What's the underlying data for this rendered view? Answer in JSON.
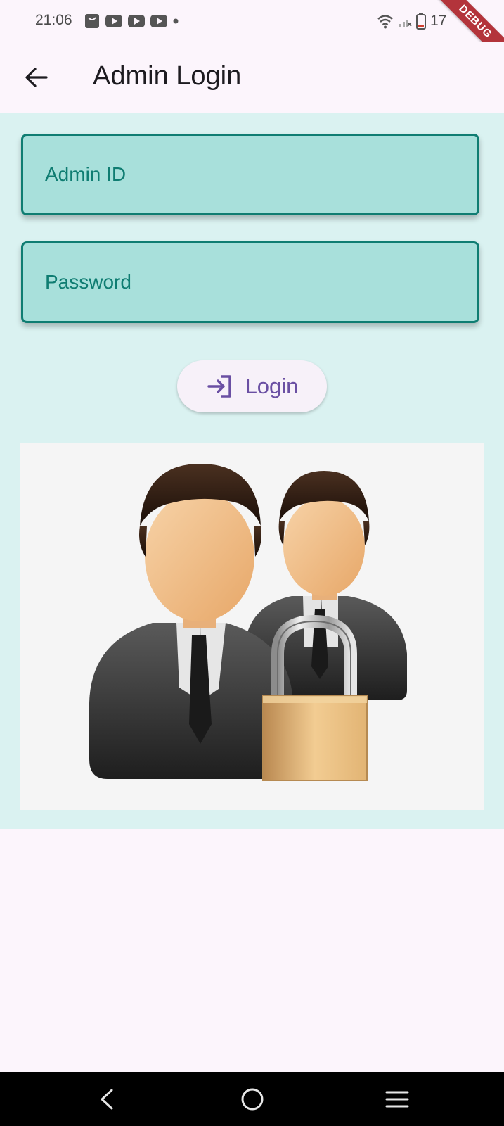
{
  "status_bar": {
    "time": "21:06",
    "battery_text": "17",
    "debug_label": "DEBUG",
    "notification_icons": [
      "bag-icon",
      "youtube-icon",
      "youtube-icon",
      "youtube-icon",
      "dot-icon"
    ],
    "system_icons": [
      "wifi-icon",
      "signal-icon",
      "battery-icon"
    ]
  },
  "app_bar": {
    "title": "Admin Login",
    "back_icon": "arrow-left-icon"
  },
  "form": {
    "admin_id_placeholder": "Admin ID",
    "password_placeholder": "Password",
    "login_label": "Login",
    "login_icon": "login-arrow-icon"
  },
  "illustration": {
    "icon": "admin-users-lock-icon"
  },
  "nav_bar": {
    "icons": [
      "nav-back-icon",
      "nav-home-icon",
      "nav-menu-icon"
    ]
  },
  "colors": {
    "background": "#fcf5fc",
    "content_background": "#daf2f1",
    "field_fill": "#a8e0db",
    "field_border": "#0f7d72",
    "accent_purple": "#6a4fa3",
    "debug_banner": "#b3343b"
  }
}
